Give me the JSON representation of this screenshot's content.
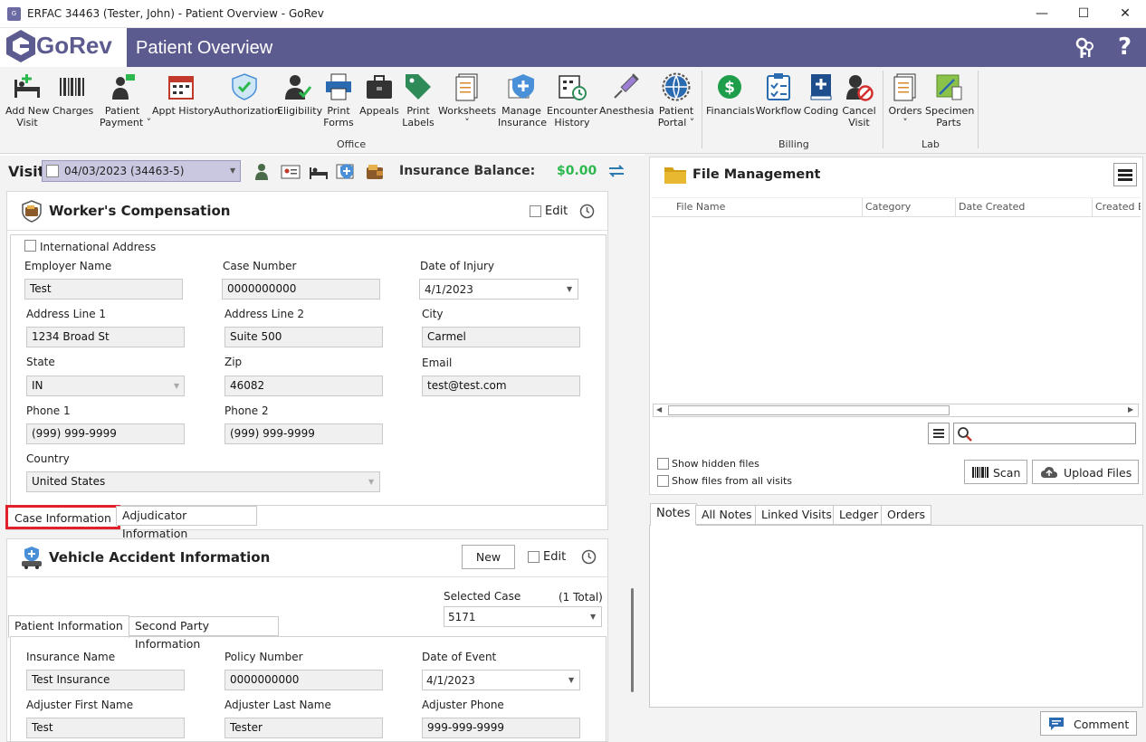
{
  "window": {
    "title": "ERFAC 34463 (Tester, John) - Patient Overview - GoRev",
    "minimize": "—",
    "maximize": "☐",
    "close": "✕"
  },
  "header": {
    "logo": "GoRev",
    "title": "Patient Overview",
    "help": "?"
  },
  "ribbon": {
    "office": [
      {
        "label": "Add New\nVisit"
      },
      {
        "label": "Charges"
      },
      {
        "label": "Patient\nPayment ˅"
      },
      {
        "label": "Appt History"
      },
      {
        "label": "Authorization"
      },
      {
        "label": "Eligibility"
      },
      {
        "label": "Print\nForms"
      },
      {
        "label": "Appeals"
      },
      {
        "label": "Print\nLabels"
      },
      {
        "label": "Worksheets\n˅"
      },
      {
        "label": "Manage\nInsurance"
      },
      {
        "label": "Encounter\nHistory"
      },
      {
        "label": "Anesthesia"
      },
      {
        "label": "Patient\nPortal ˅"
      }
    ],
    "billing": [
      {
        "label": "Financials"
      },
      {
        "label": "Workflow"
      },
      {
        "label": "Coding"
      },
      {
        "label": "Cancel\nVisit"
      }
    ],
    "lab": [
      {
        "label": "Orders\n˅"
      },
      {
        "label": "Specimen\nParts"
      }
    ],
    "groups": {
      "office": "Office",
      "billing": "Billing",
      "lab": "Lab"
    }
  },
  "visitbar": {
    "label": "Visit",
    "value": "04/03/2023 (34463-5)",
    "balance_label": "Insurance Balance:",
    "balance_value": "$0.00",
    "balance_color": "#2db84d"
  },
  "workers_comp": {
    "title": "Worker's Compensation",
    "edit_label": "Edit",
    "international_label": "International Address",
    "fields": {
      "employer_name": {
        "label": "Employer Name",
        "value": "Test"
      },
      "case_number": {
        "label": "Case Number",
        "value": "0000000000"
      },
      "date_of_injury": {
        "label": "Date of Injury",
        "value": "4/1/2023"
      },
      "address1": {
        "label": "Address Line 1",
        "value": "1234 Broad St"
      },
      "address2": {
        "label": "Address Line 2",
        "value": "Suite 500"
      },
      "city": {
        "label": "City",
        "value": "Carmel"
      },
      "state": {
        "label": "State",
        "value": "IN"
      },
      "zip": {
        "label": "Zip",
        "value": "46082"
      },
      "email": {
        "label": "Email",
        "value": "test@test.com"
      },
      "phone1": {
        "label": "Phone 1",
        "value": "(999) 999-9999"
      },
      "phone2": {
        "label": "Phone 2",
        "value": "(999) 999-9999"
      },
      "country": {
        "label": "Country",
        "value": "United States"
      }
    },
    "tabs": [
      "Case Information",
      "Adjudicator Information"
    ],
    "highlight_color": "#e0202a"
  },
  "vehicle": {
    "title": "Vehicle Accident Information",
    "new_label": "New",
    "edit_label": "Edit",
    "selected_case_label": "Selected Case",
    "total": "(1 Total)",
    "selected_case_value": "5171",
    "tabs": [
      "Patient Information",
      "Second Party Information"
    ],
    "fields": {
      "insurance_name": {
        "label": "Insurance Name",
        "value": "Test Insurance"
      },
      "policy_number": {
        "label": "Policy Number",
        "value": "0000000000"
      },
      "date_of_event": {
        "label": "Date of Event",
        "value": "4/1/2023"
      },
      "adj_first": {
        "label": "Adjuster First Name",
        "value": "Test"
      },
      "adj_last": {
        "label": "Adjuster Last Name",
        "value": "Tester"
      },
      "adj_phone": {
        "label": "Adjuster Phone",
        "value": "999-999-9999"
      }
    }
  },
  "files": {
    "title": "File Management",
    "columns": [
      "File Name",
      "Category",
      "Date Created",
      "Created B"
    ],
    "show_hidden": "Show hidden files",
    "show_all": "Show files from all visits",
    "scan": "Scan",
    "upload": "Upload Files"
  },
  "notes": {
    "tabs": [
      "Notes",
      "All Notes",
      "Linked Visits",
      "Ledger",
      "Orders"
    ],
    "comment": "Comment"
  }
}
